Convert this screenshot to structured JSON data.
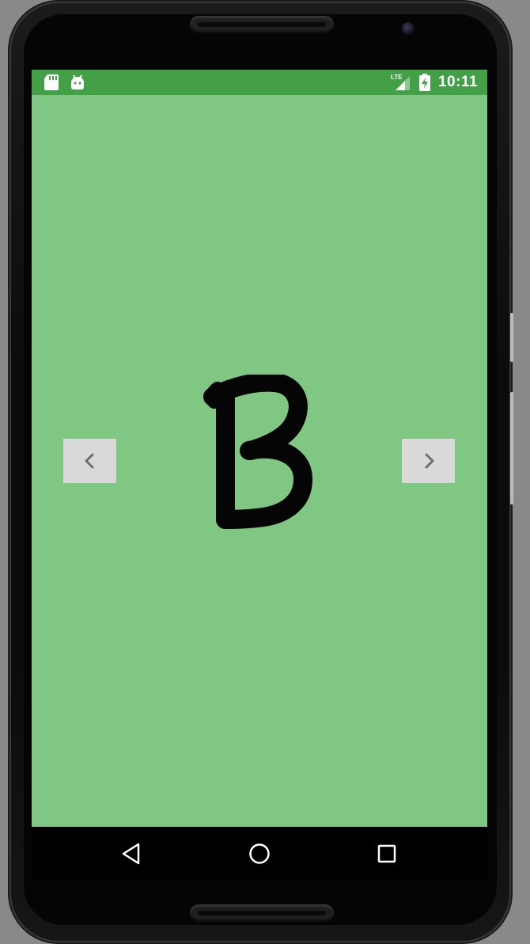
{
  "status_bar": {
    "time": "10:11",
    "network": "LTE",
    "left_icons": [
      "sd-card-icon",
      "android-icon"
    ],
    "right_icons": [
      "lte-signal-icon",
      "battery-charging-icon"
    ],
    "background_color": "#43a047"
  },
  "content": {
    "background_color": "#81c784",
    "displayed_letter": "B",
    "prev_button_icon": "chevron-left-icon",
    "next_button_icon": "chevron-right-icon"
  },
  "navigation_bar": {
    "buttons": [
      "back-icon",
      "home-icon",
      "recents-icon"
    ]
  }
}
